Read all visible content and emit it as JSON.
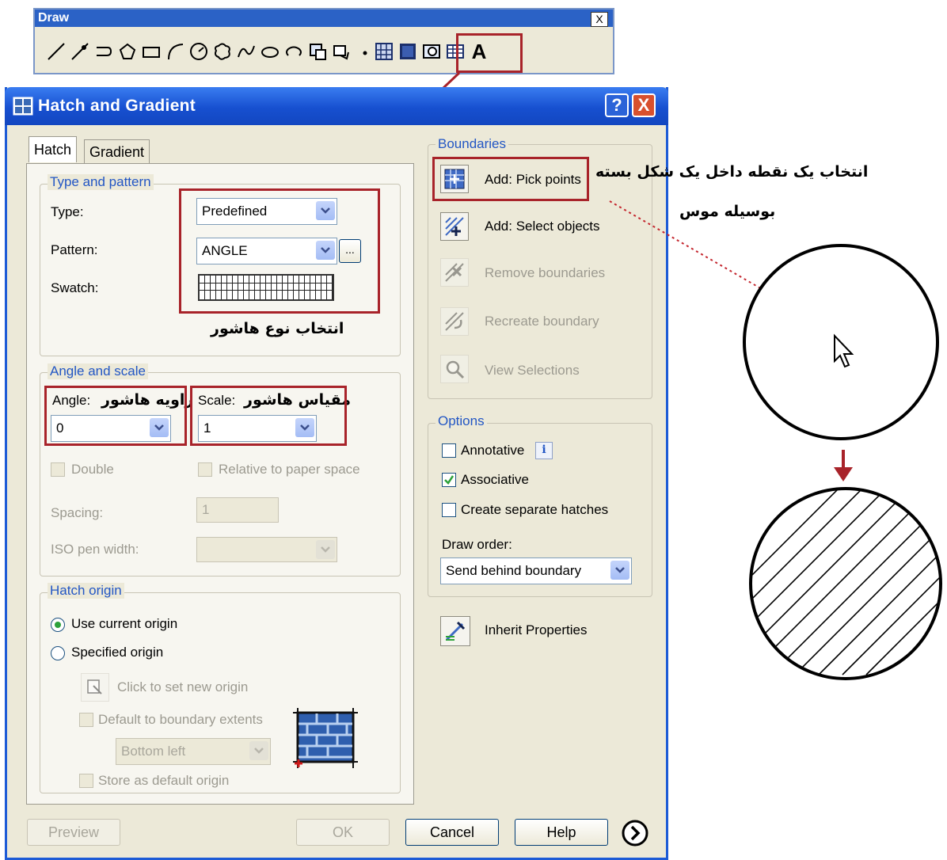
{
  "toolbar": {
    "title": "Draw",
    "close_label": "X",
    "text_tool_label": "A",
    "icons": [
      "line-icon",
      "construction-line-icon",
      "polyline-icon",
      "polygon-icon",
      "rectangle-icon",
      "arc-icon",
      "circle-icon",
      "revision-cloud-icon",
      "spline-icon",
      "ellipse-icon",
      "ellipse-arc-icon",
      "insert-block-icon",
      "make-block-icon",
      "point-icon",
      "hatch-icon",
      "gradient-icon",
      "region-icon",
      "table-icon",
      "multiline-text-icon"
    ]
  },
  "dialog": {
    "title": "Hatch and Gradient",
    "help_button": "?",
    "close_button": "X",
    "tabs": {
      "hatch": "Hatch",
      "gradient": "Gradient"
    },
    "type_and_pattern": {
      "legend": "Type and pattern",
      "type_label": "Type:",
      "type_value": "Predefined",
      "pattern_label": "Pattern:",
      "pattern_value": "ANGLE",
      "pattern_browse": "...",
      "swatch_label": "Swatch:"
    },
    "angle_and_scale": {
      "legend": "Angle and scale",
      "angle_label": "Angle:",
      "angle_value": "0",
      "scale_label": "Scale:",
      "scale_value": "1",
      "double_label": "Double",
      "relative_label": "Relative to paper space",
      "spacing_label": "Spacing:",
      "spacing_value": "1",
      "iso_label": "ISO pen width:"
    },
    "hatch_origin": {
      "legend": "Hatch origin",
      "use_current": "Use current origin",
      "specified": "Specified origin",
      "click_set": "Click to set new origin",
      "default_extents": "Default to boundary extents",
      "position_value": "Bottom left",
      "store_default": "Store as default origin"
    },
    "boundaries": {
      "legend": "Boundaries",
      "pick_points": "Add: Pick points",
      "select_objects": "Add: Select objects",
      "remove": "Remove boundaries",
      "recreate": "Recreate boundary",
      "view": "View Selections"
    },
    "options": {
      "legend": "Options",
      "annotative": "Annotative",
      "info_icon_text": "i",
      "associative": "Associative",
      "separate": "Create separate hatches",
      "draw_order_label": "Draw order:",
      "draw_order_value": "Send behind boundary"
    },
    "inherit": "Inherit Properties",
    "buttons": {
      "preview": "Preview",
      "ok": "OK",
      "cancel": "Cancel",
      "help": "Help"
    },
    "state": {
      "use_current_origin": true,
      "associative": true,
      "annotative": false,
      "separate": false
    }
  },
  "annotations": {
    "pattern_type": "انتخاب نوع هاشور",
    "angle": "زاویه هاشور",
    "scale": "مقیاس هاشور",
    "pick_point_line1": "انتخاب یک نقطه  داخل یک شکل بسته",
    "pick_point_line2": "بوسیله موس"
  },
  "colors": {
    "highlight": "#a8232a",
    "title_blue": "#1750d0",
    "legend_blue": "#2256c4"
  }
}
